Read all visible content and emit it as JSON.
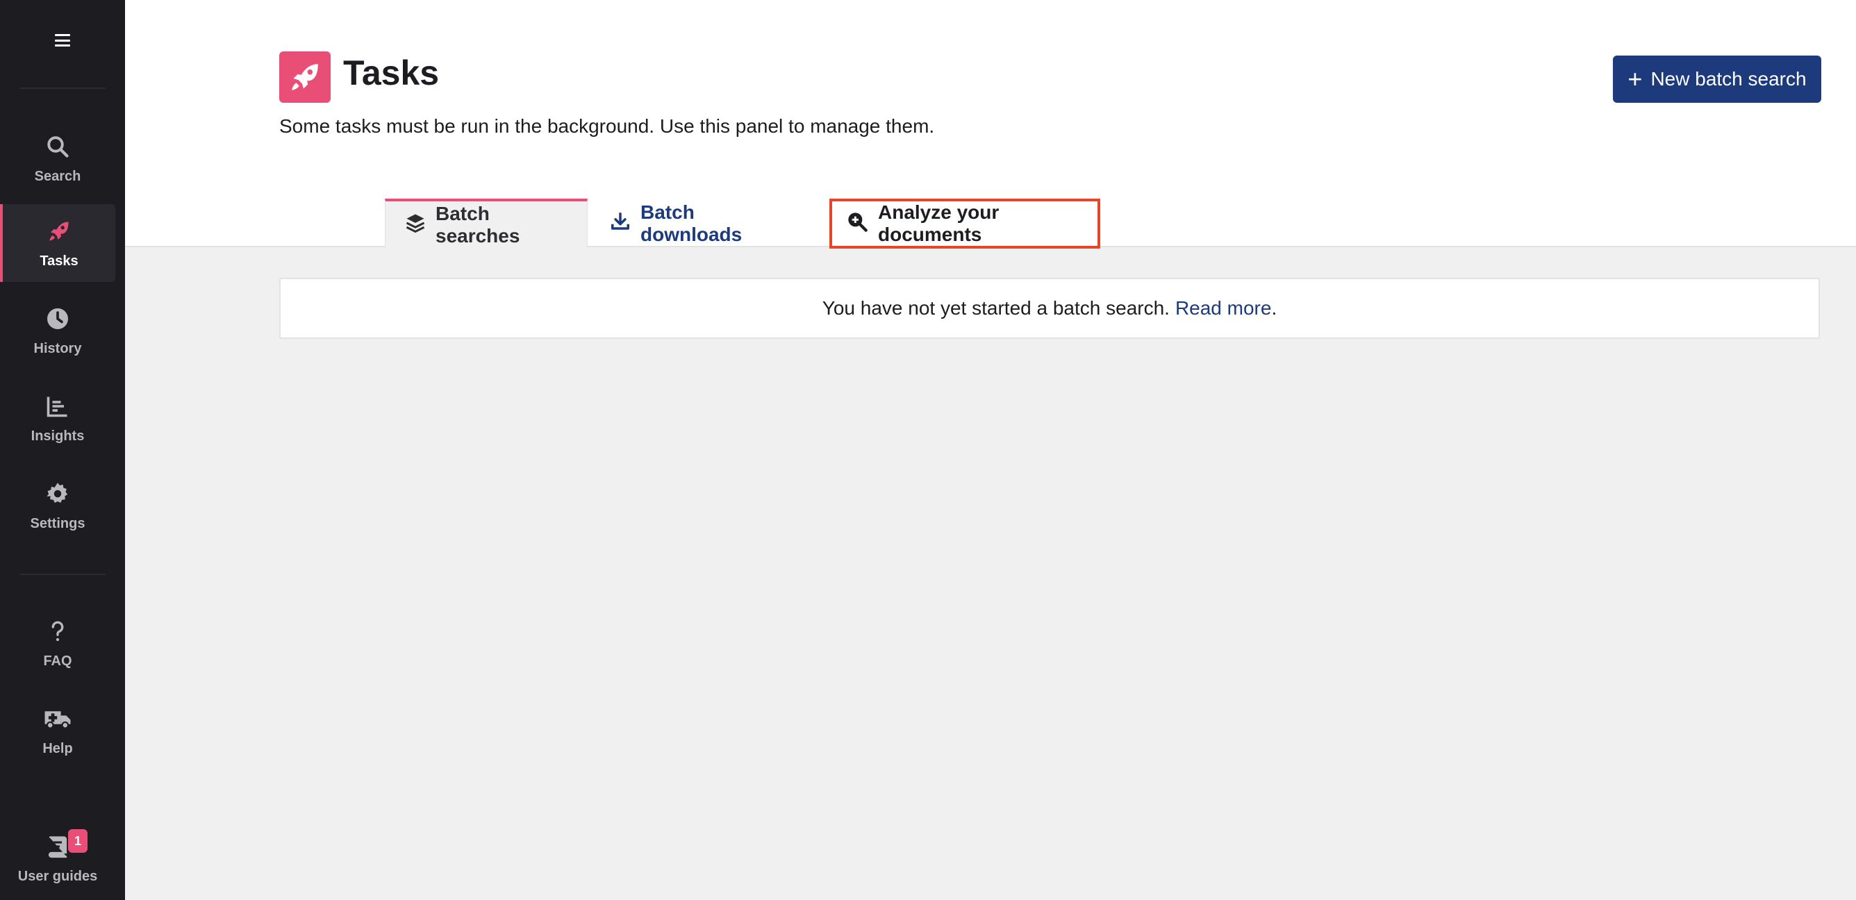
{
  "sidebar": {
    "items": [
      {
        "label": "Search",
        "icon": "search-icon"
      },
      {
        "label": "Tasks",
        "icon": "rocket-icon",
        "active": true
      },
      {
        "label": "History",
        "icon": "clock-icon"
      },
      {
        "label": "Insights",
        "icon": "chart-icon"
      },
      {
        "label": "Settings",
        "icon": "gear-icon"
      },
      {
        "label": "FAQ",
        "icon": "question-icon"
      },
      {
        "label": "Help",
        "icon": "ambulance-icon"
      },
      {
        "label": "User guides",
        "icon": "book-icon",
        "badge": "1"
      }
    ]
  },
  "header": {
    "title": "Tasks",
    "description": "Some tasks must be run in the background. Use this panel to manage them.",
    "new_batch_label": "New batch search"
  },
  "tabs": [
    {
      "label": "Batch searches",
      "icon": "layers-icon",
      "active": true
    },
    {
      "label": "Batch downloads",
      "icon": "download-icon"
    },
    {
      "label": "Analyze your documents",
      "icon": "search-plus-icon",
      "highlighted": true
    }
  ],
  "empty_state": {
    "message": "You have not yet started a batch search.",
    "link_text": "Read more",
    "suffix": "."
  },
  "colors": {
    "sidebar_bg": "#1d1c21",
    "accent_pink": "#e94e76",
    "primary_blue": "#1c3a7c",
    "highlight_red": "#e4462a",
    "content_bg": "#f1f0f1"
  }
}
